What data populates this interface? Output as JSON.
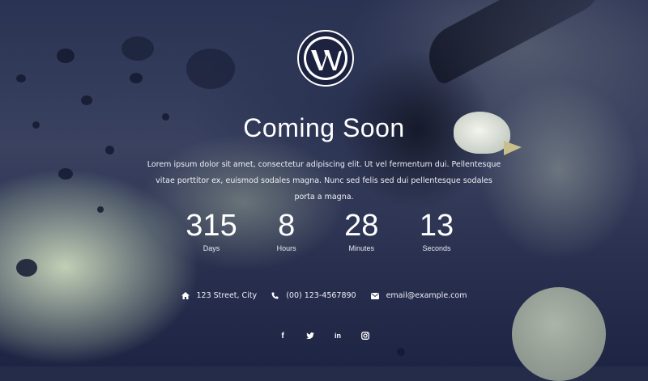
{
  "page": {
    "title": "Coming Soon",
    "description": "Lorem ipsum dolor sit amet, consectetur adipiscing elit. Ut vel fermentum dui. Pellentesque vitae porttitor ex, euismod sodales magna. Nunc sed felis sed dui pellentesque sodales porta a magna."
  },
  "logo": {
    "icon": "wordpress-logo"
  },
  "countdown": {
    "days": {
      "value": "315",
      "label": "Days"
    },
    "hours": {
      "value": "8",
      "label": "Hours"
    },
    "minutes": {
      "value": "28",
      "label": "Minutes"
    },
    "seconds": {
      "value": "13",
      "label": "Seconds"
    }
  },
  "contact": {
    "address": {
      "icon": "home-icon",
      "text": "123 Street, City"
    },
    "phone": {
      "icon": "phone-icon",
      "text": "(00) 123-4567890"
    },
    "email": {
      "icon": "envelope-icon",
      "text": "email@example.com"
    }
  },
  "social": [
    {
      "name": "facebook",
      "glyph": "f"
    },
    {
      "name": "twitter",
      "glyph": "t"
    },
    {
      "name": "linkedin",
      "glyph": "in"
    },
    {
      "name": "instagram",
      "glyph": "◎"
    }
  ],
  "colors": {
    "background": "#2b3354",
    "text": "#ffffff"
  }
}
